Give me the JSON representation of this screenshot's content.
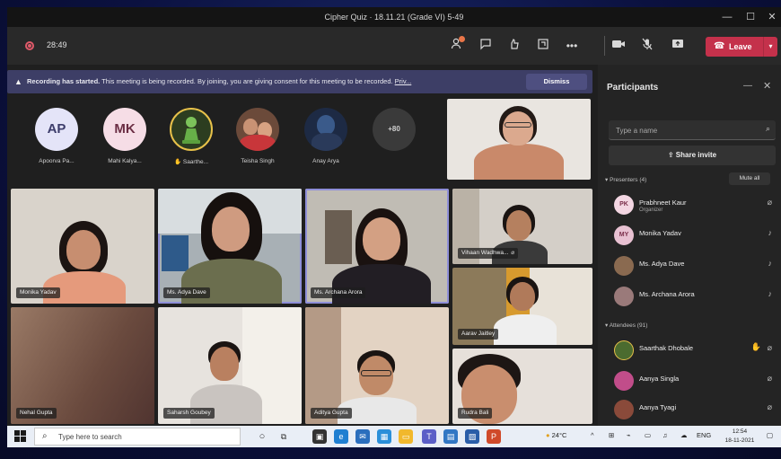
{
  "window": {
    "title": "Cipher Quiz · 18.11.21 (Grade VI) 5-49",
    "controls": {
      "minimize": "—",
      "maximize": "☐",
      "close": "✕"
    }
  },
  "toolbar": {
    "timer": "28:49",
    "leave_label": "Leave",
    "icons": [
      "participants-icon",
      "chat-icon",
      "reactions-icon",
      "rooms-icon",
      "more-icon",
      "camera-icon",
      "mic-off-icon",
      "share-icon"
    ]
  },
  "banner": {
    "bold_text": "Recording has started.",
    "text": " This meeting is being recorded. By joining, you are giving consent for this meeting to be recorded.",
    "link": "Priv...",
    "dismiss_label": "Dismiss"
  },
  "avatars": [
    {
      "initials": "AP",
      "name": "Apoorva Pa...",
      "bg": "#e4e4f8",
      "fg": "#3d3d6b"
    },
    {
      "initials": "MK",
      "name": "Mahi Kalya...",
      "bg": "#f6dde6",
      "fg": "#6b2e44"
    },
    {
      "initials": "",
      "name": "Saarthe...",
      "bg": "#3a5a2a",
      "fg": "#ffffff"
    },
    {
      "initials": "",
      "name": "Teisha Singh",
      "bg": "#6b4a3a",
      "fg": "#ffffff"
    },
    {
      "initials": "",
      "name": "Anay Arya",
      "bg": "#1d2a44",
      "fg": "#ffffff"
    },
    {
      "initials": "+80",
      "name": "",
      "bg": "#3a3a3a",
      "fg": "#d0d0d0"
    }
  ],
  "tiles": {
    "monika": "Monika Yadav",
    "adya": "Ms. Adya Dave",
    "archana": "Ms. Archana Arora",
    "vihaan": "Vihaan Wadhwa...",
    "aarav": "Aarav Jaitley",
    "nehal": "Nehal Gupta",
    "saharsh": "Saharsh Goubey",
    "aditya": "Aditya Gupta",
    "rudra": "Rudra Bali"
  },
  "panel": {
    "title": "Participants",
    "search_placeholder": "Type a name",
    "share_invite": "Share invite",
    "presenters_label": "Presenters (4)",
    "mute_all": "Mute all",
    "attendees_label": "Attendees (91)",
    "presenters": [
      {
        "initials": "PK",
        "name": "Prabhneet Kaur",
        "role": "Organizer",
        "bg": "#f3d6e2"
      },
      {
        "initials": "MY",
        "name": "Monika Yadav",
        "role": "",
        "bg": "#e8c1d2"
      },
      {
        "initials": "",
        "name": "Ms. Adya Dave",
        "role": "",
        "bg": "#8a6a50"
      },
      {
        "initials": "",
        "name": "Ms. Archana Arora",
        "role": "",
        "bg": "#9a7a7a"
      }
    ],
    "attendees": [
      {
        "initials": "",
        "name": "Saarthak Dhobale",
        "bg": "#4b6b2f"
      },
      {
        "initials": "",
        "name": "Aanya Singla",
        "bg": "#c14d8a"
      },
      {
        "initials": "",
        "name": "Aanya Tyagi",
        "bg": "#8a4a3a"
      }
    ]
  },
  "taskbar": {
    "search_placeholder": "Type here to search",
    "weather": "24°C",
    "lang": "ENG",
    "time": "12:54",
    "date": "18-11-2021"
  }
}
